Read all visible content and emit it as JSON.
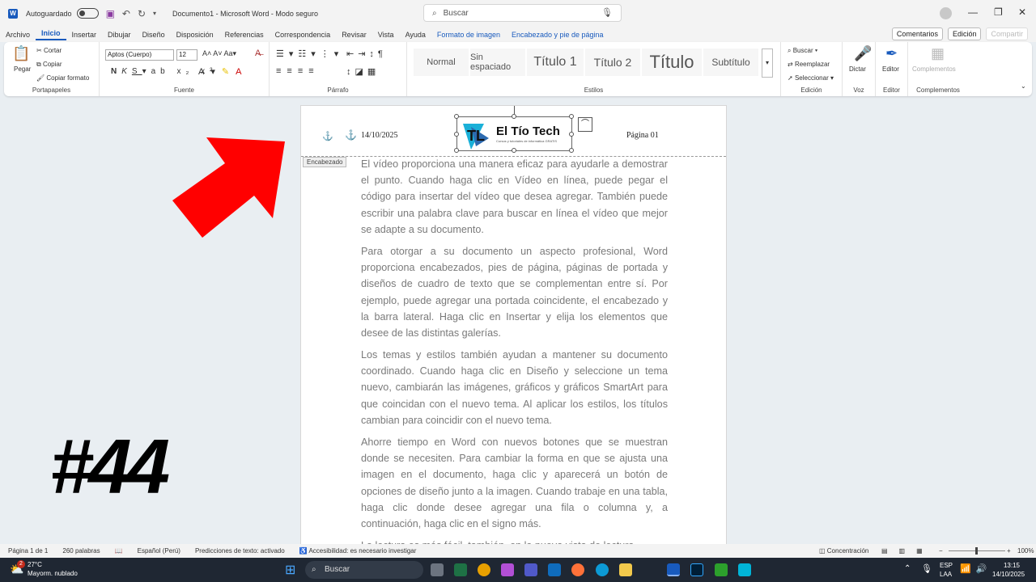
{
  "titlebar": {
    "app_icon": "W",
    "autosave_label": "Autoguardado",
    "doc_title": "Documento1 - Microsoft Word - Modo seguro",
    "search_placeholder": "Buscar"
  },
  "menu": {
    "items": [
      "Archivo",
      "Inicio",
      "Insertar",
      "Dibujar",
      "Diseño",
      "Disposición",
      "Referencias",
      "Correspondencia",
      "Revisar",
      "Vista",
      "Ayuda"
    ],
    "context_items": [
      "Formato de imagen",
      "Encabezado y pie de página"
    ],
    "comments_label": "Comentarios",
    "editing_label": "Edición",
    "share_label": "Compartir"
  },
  "ribbon": {
    "clipboard": {
      "paste": "Pegar",
      "cut": "Cortar",
      "copy": "Copiar",
      "format_painter": "Copiar formato",
      "label": "Portapapeles"
    },
    "font": {
      "name": "Aptos (Cuerpo)",
      "size": "12",
      "label": "Fuente"
    },
    "paragraph": {
      "label": "Párrafo"
    },
    "styles": {
      "items": [
        "Normal",
        "Sin espaciado",
        "Título 1",
        "Título 2",
        "Título",
        "Subtítulo"
      ],
      "label": "Estilos"
    },
    "editing": {
      "find": "Buscar",
      "replace": "Reemplazar",
      "select": "Seleccionar",
      "label": "Edición"
    },
    "voice": {
      "dictate": "Dictar",
      "label": "Voz"
    },
    "editor": {
      "btn": "Editor",
      "label": "Editor"
    },
    "addins": {
      "btn": "Complementos",
      "label": "Complementos"
    }
  },
  "header": {
    "date": "14/10/2025",
    "page": "Página 01",
    "tag": "Encabezado",
    "logo_title": "El Tío Tech",
    "logo_subtitle": "Cursos y tutoriales de informática GRATIS"
  },
  "paragraphs": [
    "El vídeo proporciona una manera eficaz para ayudarle a demostrar el punto. Cuando haga clic en Vídeo en línea, puede pegar el código para insertar del vídeo que desea agregar. También puede escribir una palabra clave para buscar en línea el vídeo que mejor se adapte a su documento.",
    "Para otorgar a su documento un aspecto profesional, Word proporciona encabezados, pies de página, páginas de portada y diseños de cuadro de texto que se complementan entre sí. Por ejemplo, puede agregar una portada coincidente, el encabezado y la barra lateral. Haga clic en Insertar y elija los elementos que desee de las distintas galerías.",
    "Los temas y estilos también ayudan a mantener su documento coordinado. Cuando haga clic en Diseño y seleccione un tema nuevo, cambiarán las imágenes, gráficos y gráficos SmartArt para que coincidan con el nuevo tema. Al aplicar los estilos, los títulos cambian para coincidir con el nuevo tema.",
    "Ahorre tiempo en Word con nuevos botones que se muestran donde se necesiten. Para cambiar la forma en que se ajusta una imagen en el documento, haga clic y aparecerá un botón de opciones de diseño junto a la imagen. Cuando trabaje en una tabla, haga clic donde desee agregar una fila o columna y, a continuación, haga clic en el signo más.",
    "La lectura es más fácil, también, en la nueva vista de lectura."
  ],
  "overlay": {
    "episode": "#44"
  },
  "status": {
    "page": "Página 1 de 1",
    "words": "260 palabras",
    "language": "Español (Perú)",
    "predictions": "Predicciones de texto: activado",
    "accessibility": "Accesibilidad: es necesario investigar",
    "focus": "Concentración",
    "zoom": "100%"
  },
  "taskbar": {
    "weather_temp": "27°C",
    "weather_desc": "Mayorm. nublado",
    "weather_badge": "2",
    "search": "Buscar",
    "lang1": "ESP",
    "lang2": "LAA",
    "time": "13:15",
    "date": "14/10/2025"
  },
  "colors": {
    "accent": "#185abd",
    "arrow": "#ff0000"
  }
}
